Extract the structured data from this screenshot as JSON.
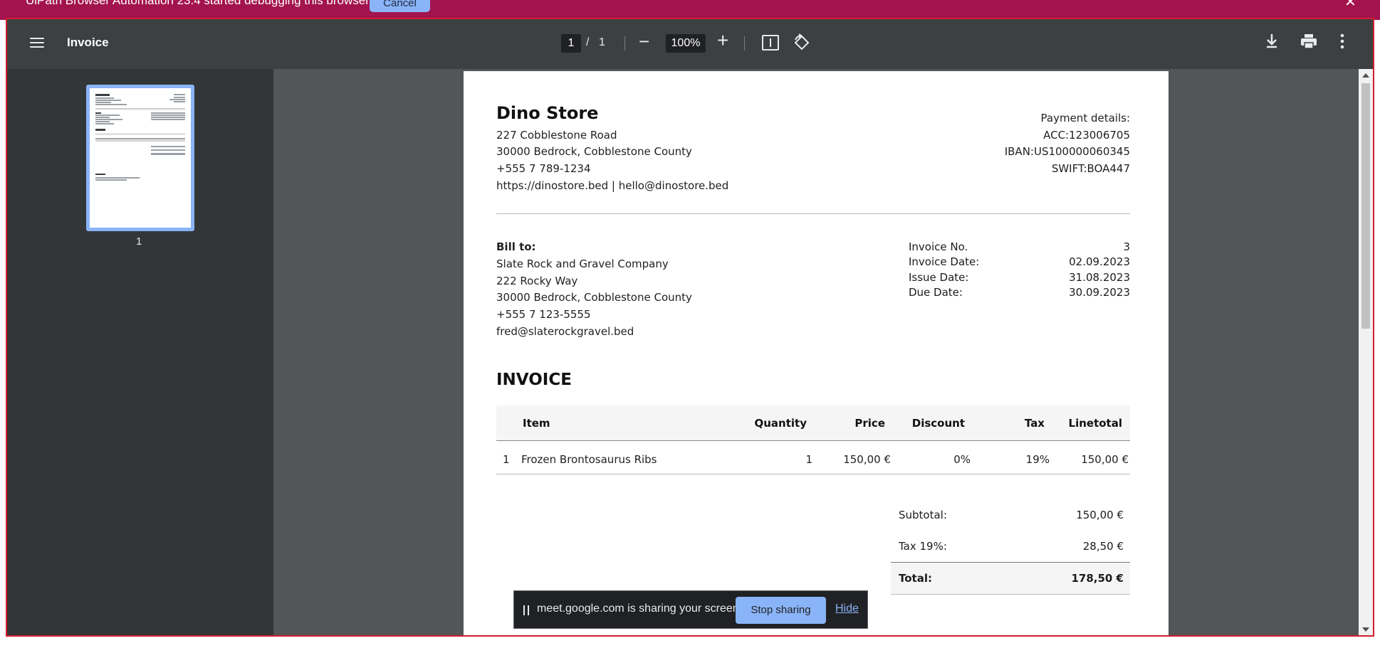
{
  "infobar": {
    "message": "UiPath Browser Automation 23.4 started debugging this browser",
    "cancel_label": "Cancel",
    "close_icon": "close-icon"
  },
  "toolbar": {
    "title": "Invoice",
    "current_page": "1",
    "separator": "/",
    "total_pages": "1",
    "zoom": "100%",
    "icons": [
      "menu-icon",
      "zoom-out-icon",
      "zoom-in-icon",
      "fit-page-icon",
      "rotate-icon",
      "download-icon",
      "print-icon",
      "more-options-icon"
    ]
  },
  "sidebar": {
    "thumbnail_page_number": "1"
  },
  "invoice": {
    "store": {
      "name": "Dino Store",
      "address_line1": "227 Cobblestone Road",
      "address_line2": "30000 Bedrock, Cobblestone County",
      "phone": "+555 7 789-1234",
      "web_email": "https://dinostore.bed | hello@dinostore.bed"
    },
    "payment": {
      "heading": "Payment details:",
      "acc": "ACC:123006705",
      "iban": "IBAN:US100000060345",
      "swift": "SWIFT:BOA447"
    },
    "bill_to": {
      "label": "Bill to:",
      "company": "Slate Rock and Gravel Company",
      "address_line1": "222 Rocky Way",
      "address_line2": "30000 Bedrock, Cobblestone County",
      "phone": "+555 7 123-5555",
      "email": "fred@slaterockgravel.bed"
    },
    "meta": {
      "invoice_no_label": "Invoice No.",
      "invoice_no": "3",
      "invoice_date_label": "Invoice Date:",
      "invoice_date": "02.09.2023",
      "issue_date_label": "Issue Date:",
      "issue_date": "31.08.2023",
      "due_date_label": "Due Date:",
      "due_date": "30.09.2023"
    },
    "heading": "INVOICE",
    "table": {
      "headers": [
        "Item",
        "Quantity",
        "Price",
        "Discount",
        "Tax",
        "Linetotal"
      ],
      "rows": [
        {
          "num": "1",
          "item": "Frozen Brontosaurus Ribs",
          "quantity": "1",
          "price": "150,00 €",
          "discount": "0%",
          "tax": "19%",
          "linetotal": "150,00 €"
        }
      ]
    },
    "summary": {
      "subtotal_label": "Subtotal:",
      "subtotal": "150,00 €",
      "tax_label": "Tax 19%:",
      "tax": "28,50 €",
      "total_label": "Total:",
      "total": "178,50 €"
    }
  },
  "share_bar": {
    "message": "meet.google.com is sharing your screen.",
    "stop_label": "Stop sharing",
    "hide_label": "Hide"
  },
  "colors": {
    "infobar_bg": "#a3144e",
    "toolbar_bg": "#3c4043",
    "sidebar_bg": "#323639",
    "viewer_bg": "#525659",
    "accent": "#8ab4f8",
    "debug_frame": "#d51d2e"
  }
}
